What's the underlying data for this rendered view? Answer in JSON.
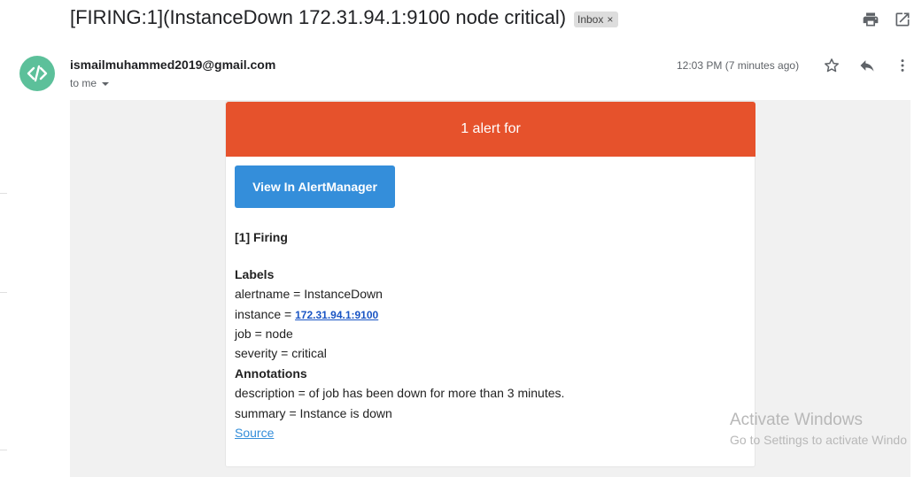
{
  "subject": "[FIRING:1](InstanceDown 172.31.94.1:9100 node critical)",
  "label_chip": {
    "text": "Inbox",
    "remove": "×"
  },
  "sender": {
    "email": "ismailmuhammed2019@gmail.com",
    "to": "to me"
  },
  "time": "12:03 PM (7 minutes ago)",
  "email": {
    "banner": "1 alert for",
    "button": "View In AlertManager",
    "firing": "[1] Firing",
    "labels_heading": "Labels",
    "labels": {
      "alertname": "alertname = InstanceDown",
      "instance_prefix": "instance = ",
      "instance_link": "172.31.94.1:9100",
      "job": "job = node",
      "severity": "severity = critical"
    },
    "annotations_heading": "Annotations",
    "annotations": {
      "description": "description = of job has been down for more than 3 minutes.",
      "summary": "summary = Instance is down"
    },
    "source": "Source"
  },
  "watermark": {
    "line1": "Activate Windows",
    "line2": "Go to Settings to activate Windo"
  },
  "icons": {
    "print": "print-icon",
    "open_new": "open-in-new-window-icon",
    "star": "star-icon",
    "reply": "reply-icon",
    "more": "more-vert-icon",
    "avatar": "code-avatar-icon"
  },
  "colors": {
    "banner": "#e6522c",
    "button": "#348eda",
    "avatar": "#5cc09a"
  }
}
